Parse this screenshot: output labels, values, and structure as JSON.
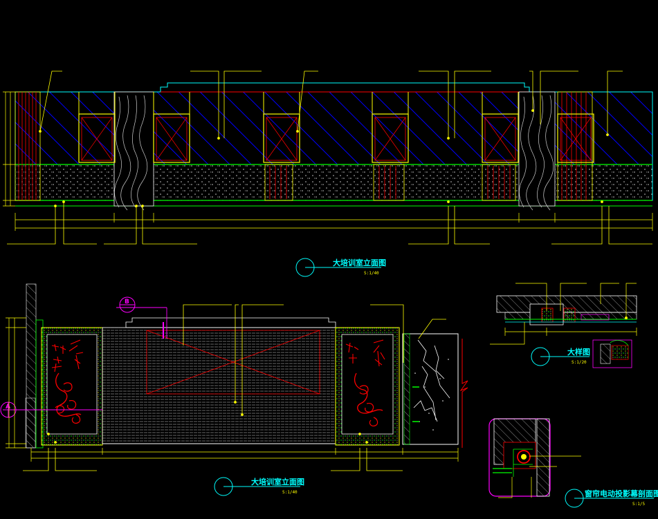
{
  "colors": {
    "background": "#000000",
    "cyan": "#00ffff",
    "yellow": "#ffff00",
    "green": "#00ff00",
    "red": "#ff0000",
    "blue": "#0000ff",
    "white": "#ffffff",
    "magenta": "#ff00ff",
    "gray": "#9a9a9a"
  },
  "drawings": {
    "elevation_top": {
      "title": "大培训室立面图",
      "scale": "S:1/40"
    },
    "elevation_bottom": {
      "title": "大培训室立面图",
      "scale": "S:1/40",
      "marker_b": "B",
      "marker_a": "A"
    },
    "detail_large": {
      "title": "大样图",
      "scale": "S:1/20"
    },
    "detail_section": {
      "title": "窗帘电动投影幕剖面图",
      "scale": "S:1/5"
    }
  }
}
